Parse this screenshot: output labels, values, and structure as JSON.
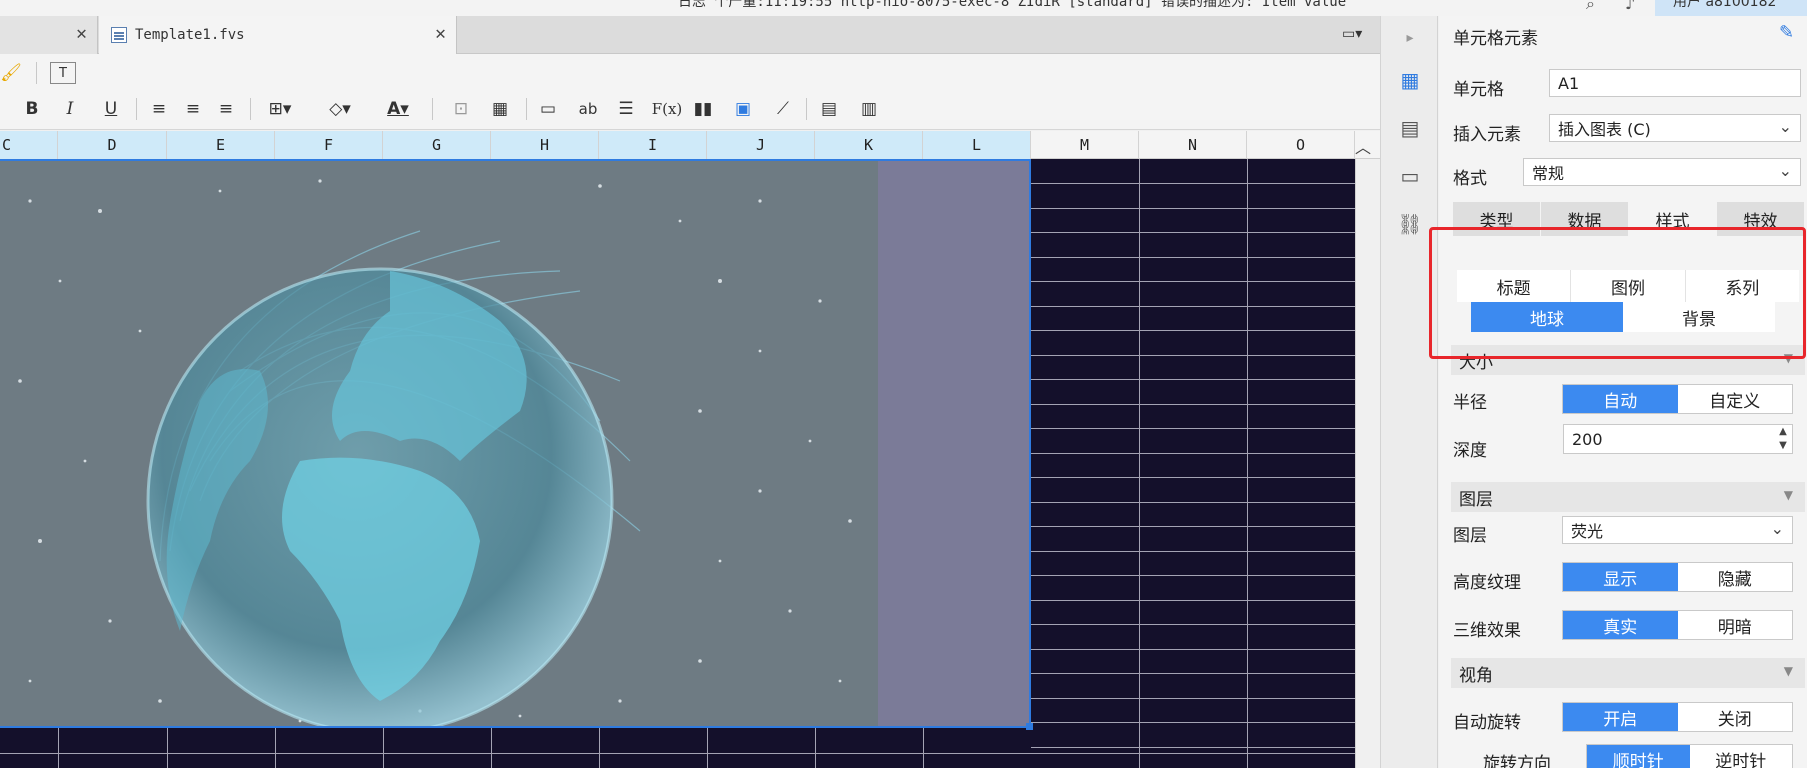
{
  "status_bar": {
    "message": "日志 个产量:11:19:55 http-nio-8075-exec-8 ZIdiR [standard] 错误的描述为: Item value",
    "user": "用户 a8100182"
  },
  "tabs": {
    "active_tab": "Template1.fvs"
  },
  "toolbar": {
    "bold": "B",
    "italic": "I",
    "underline": "U",
    "text_ab": "ab",
    "formula": "F(x)"
  },
  "columns": [
    "C",
    "D",
    "E",
    "F",
    "G",
    "H",
    "I",
    "J",
    "K",
    "L",
    "M",
    "N",
    "O"
  ],
  "panel": {
    "title": "单元格元素",
    "cell_label": "单元格",
    "cell_value": "A1",
    "insert_label": "插入元素",
    "insert_value": "插入图表 (C)",
    "format_label": "格式",
    "format_value": "常规",
    "main_tabs": [
      "类型",
      "数据",
      "样式",
      "特效"
    ],
    "sub_tabs_row1": [
      "标题",
      "图例",
      "系列"
    ],
    "sub_tabs_row2": [
      "地球",
      "背景"
    ],
    "size_section": "大小",
    "radius_label": "半径",
    "radius_options": [
      "自动",
      "自定义"
    ],
    "depth_label": "深度",
    "depth_value": "200",
    "layer_section": "图层",
    "layer_label": "图层",
    "layer_value": "荧光",
    "height_texture_label": "高度纹理",
    "height_texture_options": [
      "显示",
      "隐藏"
    ],
    "effect3d_label": "三维效果",
    "effect3d_options": [
      "真实",
      "明暗"
    ],
    "view_section": "视角",
    "autorotate_label": "自动旋转",
    "autorotate_options": [
      "开启",
      "关闭"
    ],
    "rotate_dir_label": "旋转方向",
    "rotate_dir_options": [
      "顺时针",
      "逆时针"
    ]
  },
  "colors": {
    "accent": "#3c8af0",
    "highlight_box": "#e8262b",
    "grid_bg": "#14102b",
    "selection_border": "#2f7be0"
  }
}
